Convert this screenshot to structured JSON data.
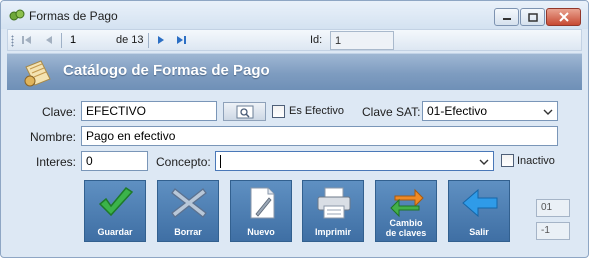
{
  "window": {
    "title": "Formas de Pago"
  },
  "navigator": {
    "position": "1",
    "of_label": "de 13",
    "id_label": "Id:",
    "id_value": "1"
  },
  "header": {
    "title": "Catálogo de Formas de Pago"
  },
  "form": {
    "clave_label": "Clave:",
    "clave_value": "EFECTIVO",
    "es_efectivo_label": "Es Efectivo",
    "clave_sat_label": "Clave SAT:",
    "clave_sat_value": "01-Efectivo",
    "nombre_label": "Nombre:",
    "nombre_value": "Pago en efectivo",
    "intereses_label": "Interes:",
    "intereses_value": "0",
    "concepto_label": "Concepto:",
    "concepto_value": "",
    "inactivo_label": "Inactivo"
  },
  "actions": {
    "guardar": "Guardar",
    "borrar": "Borrar",
    "nuevo": "Nuevo",
    "imprimir": "Imprimir",
    "cambio_line1": "Cambio",
    "cambio_line2": "de claves",
    "salir": "Salir"
  },
  "side_fields": {
    "top": "01",
    "bottom": "-1"
  }
}
